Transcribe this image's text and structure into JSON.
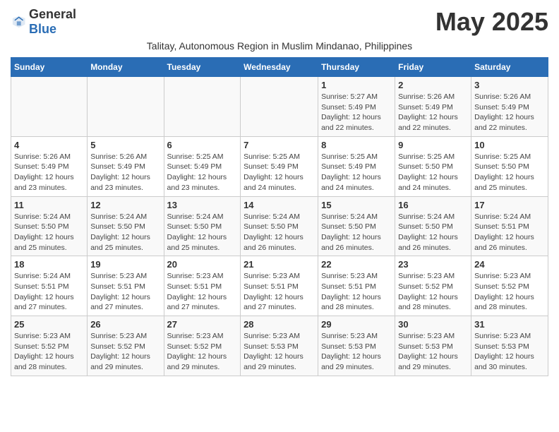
{
  "header": {
    "logo_general": "General",
    "logo_blue": "Blue",
    "month_title": "May 2025",
    "subtitle": "Talitay, Autonomous Region in Muslim Mindanao, Philippines"
  },
  "weekdays": [
    "Sunday",
    "Monday",
    "Tuesday",
    "Wednesday",
    "Thursday",
    "Friday",
    "Saturday"
  ],
  "weeks": [
    [
      {
        "day": "",
        "info": ""
      },
      {
        "day": "",
        "info": ""
      },
      {
        "day": "",
        "info": ""
      },
      {
        "day": "",
        "info": ""
      },
      {
        "day": "1",
        "info": "Sunrise: 5:27 AM\nSunset: 5:49 PM\nDaylight: 12 hours\nand 22 minutes."
      },
      {
        "day": "2",
        "info": "Sunrise: 5:26 AM\nSunset: 5:49 PM\nDaylight: 12 hours\nand 22 minutes."
      },
      {
        "day": "3",
        "info": "Sunrise: 5:26 AM\nSunset: 5:49 PM\nDaylight: 12 hours\nand 22 minutes."
      }
    ],
    [
      {
        "day": "4",
        "info": "Sunrise: 5:26 AM\nSunset: 5:49 PM\nDaylight: 12 hours\nand 23 minutes."
      },
      {
        "day": "5",
        "info": "Sunrise: 5:26 AM\nSunset: 5:49 PM\nDaylight: 12 hours\nand 23 minutes."
      },
      {
        "day": "6",
        "info": "Sunrise: 5:25 AM\nSunset: 5:49 PM\nDaylight: 12 hours\nand 23 minutes."
      },
      {
        "day": "7",
        "info": "Sunrise: 5:25 AM\nSunset: 5:49 PM\nDaylight: 12 hours\nand 24 minutes."
      },
      {
        "day": "8",
        "info": "Sunrise: 5:25 AM\nSunset: 5:49 PM\nDaylight: 12 hours\nand 24 minutes."
      },
      {
        "day": "9",
        "info": "Sunrise: 5:25 AM\nSunset: 5:50 PM\nDaylight: 12 hours\nand 24 minutes."
      },
      {
        "day": "10",
        "info": "Sunrise: 5:25 AM\nSunset: 5:50 PM\nDaylight: 12 hours\nand 25 minutes."
      }
    ],
    [
      {
        "day": "11",
        "info": "Sunrise: 5:24 AM\nSunset: 5:50 PM\nDaylight: 12 hours\nand 25 minutes."
      },
      {
        "day": "12",
        "info": "Sunrise: 5:24 AM\nSunset: 5:50 PM\nDaylight: 12 hours\nand 25 minutes."
      },
      {
        "day": "13",
        "info": "Sunrise: 5:24 AM\nSunset: 5:50 PM\nDaylight: 12 hours\nand 25 minutes."
      },
      {
        "day": "14",
        "info": "Sunrise: 5:24 AM\nSunset: 5:50 PM\nDaylight: 12 hours\nand 26 minutes."
      },
      {
        "day": "15",
        "info": "Sunrise: 5:24 AM\nSunset: 5:50 PM\nDaylight: 12 hours\nand 26 minutes."
      },
      {
        "day": "16",
        "info": "Sunrise: 5:24 AM\nSunset: 5:50 PM\nDaylight: 12 hours\nand 26 minutes."
      },
      {
        "day": "17",
        "info": "Sunrise: 5:24 AM\nSunset: 5:51 PM\nDaylight: 12 hours\nand 26 minutes."
      }
    ],
    [
      {
        "day": "18",
        "info": "Sunrise: 5:24 AM\nSunset: 5:51 PM\nDaylight: 12 hours\nand 27 minutes."
      },
      {
        "day": "19",
        "info": "Sunrise: 5:23 AM\nSunset: 5:51 PM\nDaylight: 12 hours\nand 27 minutes."
      },
      {
        "day": "20",
        "info": "Sunrise: 5:23 AM\nSunset: 5:51 PM\nDaylight: 12 hours\nand 27 minutes."
      },
      {
        "day": "21",
        "info": "Sunrise: 5:23 AM\nSunset: 5:51 PM\nDaylight: 12 hours\nand 27 minutes."
      },
      {
        "day": "22",
        "info": "Sunrise: 5:23 AM\nSunset: 5:51 PM\nDaylight: 12 hours\nand 28 minutes."
      },
      {
        "day": "23",
        "info": "Sunrise: 5:23 AM\nSunset: 5:52 PM\nDaylight: 12 hours\nand 28 minutes."
      },
      {
        "day": "24",
        "info": "Sunrise: 5:23 AM\nSunset: 5:52 PM\nDaylight: 12 hours\nand 28 minutes."
      }
    ],
    [
      {
        "day": "25",
        "info": "Sunrise: 5:23 AM\nSunset: 5:52 PM\nDaylight: 12 hours\nand 28 minutes."
      },
      {
        "day": "26",
        "info": "Sunrise: 5:23 AM\nSunset: 5:52 PM\nDaylight: 12 hours\nand 29 minutes."
      },
      {
        "day": "27",
        "info": "Sunrise: 5:23 AM\nSunset: 5:52 PM\nDaylight: 12 hours\nand 29 minutes."
      },
      {
        "day": "28",
        "info": "Sunrise: 5:23 AM\nSunset: 5:53 PM\nDaylight: 12 hours\nand 29 minutes."
      },
      {
        "day": "29",
        "info": "Sunrise: 5:23 AM\nSunset: 5:53 PM\nDaylight: 12 hours\nand 29 minutes."
      },
      {
        "day": "30",
        "info": "Sunrise: 5:23 AM\nSunset: 5:53 PM\nDaylight: 12 hours\nand 29 minutes."
      },
      {
        "day": "31",
        "info": "Sunrise: 5:23 AM\nSunset: 5:53 PM\nDaylight: 12 hours\nand 30 minutes."
      }
    ]
  ]
}
